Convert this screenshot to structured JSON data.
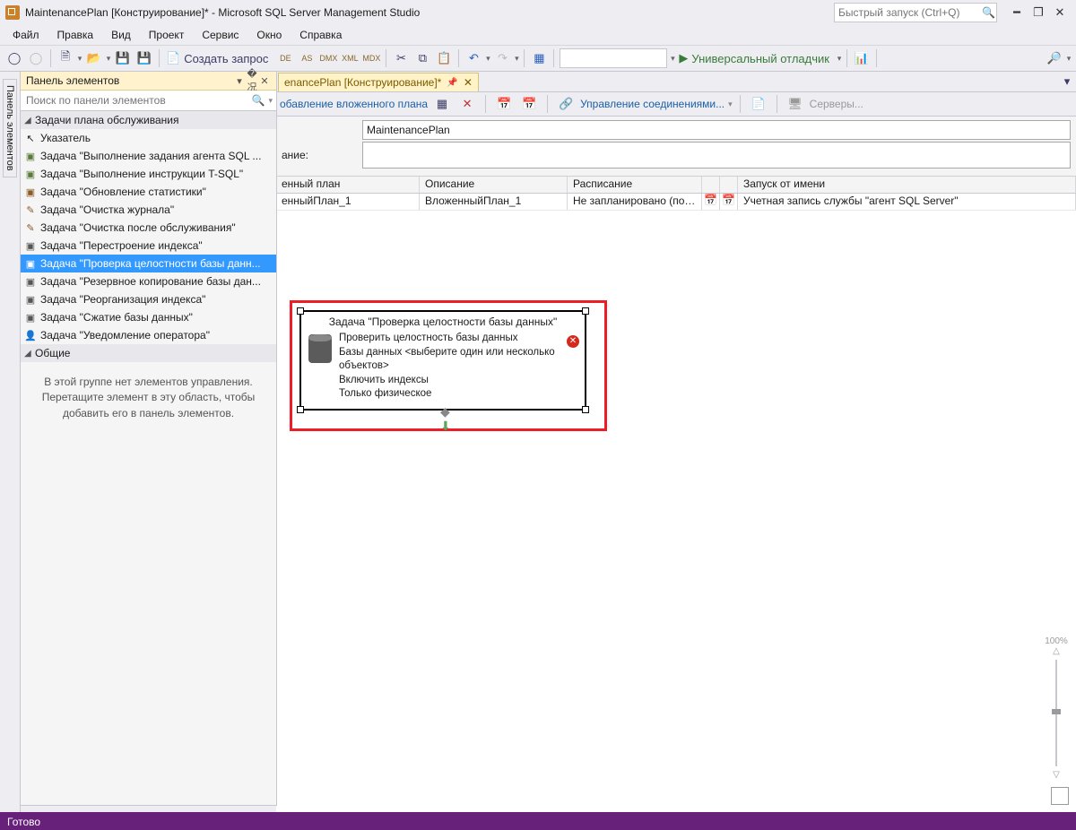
{
  "title": "MaintenancePlan [Конструирование]* - Microsoft SQL Server Management Studio",
  "quick_launch_placeholder": "Быстрый запуск (Ctrl+Q)",
  "menu": {
    "file": "Файл",
    "edit": "Правка",
    "view": "Вид",
    "project": "Проект",
    "service": "Сервис",
    "window": "Окно",
    "help": "Справка"
  },
  "toolbar": {
    "new_query": "Создать запрос",
    "debugger": "Универсальный отладчик"
  },
  "side_tab": "Панель элементов",
  "toolbox": {
    "title": "Панель элементов",
    "search_placeholder": "Поиск по панели элементов",
    "group1": "Задачи плана обслуживания",
    "items": [
      "Указатель",
      "Задача \"Выполнение задания агента SQL ...",
      "Задача \"Выполнение инструкции T-SQL\"",
      "Задача \"Обновление статистики\"",
      "Задача \"Очистка журнала\"",
      "Задача \"Очистка после обслуживания\"",
      "Задача \"Перестроение индекса\"",
      "Задача \"Проверка целостности базы данн...",
      "Задача \"Резервное копирование базы дан...",
      "Задача \"Реорганизация индекса\"",
      "Задача \"Сжатие базы данных\"",
      "Задача \"Уведомление оператора\""
    ],
    "selected_index": 7,
    "group2": "Общие",
    "note": "В этой группе нет элементов управления. Перетащите элемент в эту область, чтобы добавить его в панель элементов."
  },
  "doc_tab": {
    "label": "enancePlan [Конструирование]*"
  },
  "plan_toolbar": {
    "add_subplan": "обавление вложенного плана",
    "connections": "Управление соединениями...",
    "servers": "Серверы..."
  },
  "plan_header": {
    "name_value": "MaintenancePlan",
    "desc_label": "ание:",
    "desc_value": ""
  },
  "grid": {
    "headers": {
      "c1": "енный план",
      "c2": "Описание",
      "c3": "Расписание",
      "c6": "Запуск от имени"
    },
    "row": {
      "c1": "енныйПлан_1",
      "c2": "ВложенныйПлан_1",
      "c3": "Не запланировано (по з…",
      "c6": "Учетная запись службы \"агент SQL Server\""
    }
  },
  "task": {
    "title": "Задача \"Проверка целостности базы данных\"",
    "l1": "Проверить целостность базы данных",
    "l2": "Базы данных <выберите один или несколько объектов>",
    "l3": "Включить индексы",
    "l4": "Только физическое"
  },
  "zoom": "100%",
  "status": "Готово"
}
